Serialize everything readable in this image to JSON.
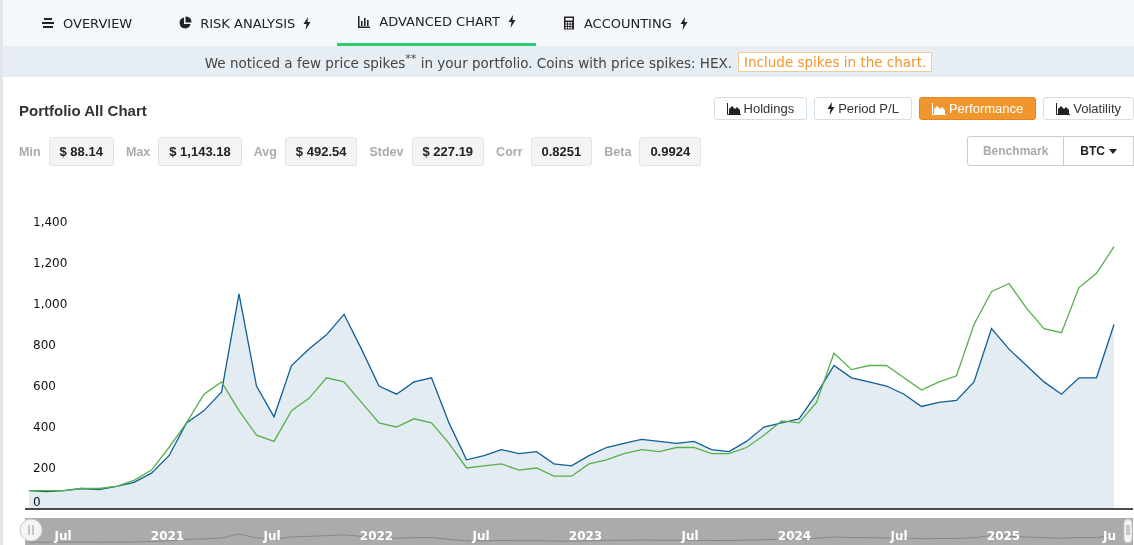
{
  "tabs": [
    {
      "label": "OVERVIEW",
      "kind": "lines",
      "bolt": false,
      "selected": false
    },
    {
      "label": "RISK ANALYSIS",
      "kind": "pie",
      "bolt": true,
      "selected": false
    },
    {
      "label": "ADVANCED CHART",
      "kind": "bars",
      "bolt": true,
      "selected": true
    },
    {
      "label": "ACCOUNTING",
      "kind": "calculator",
      "bolt": true,
      "selected": false
    }
  ],
  "banner": {
    "text": "We noticed a few price spikes$^{**}$ in your portfolio. Coins with price spikes: HEX.",
    "action": "Include spikes in the chart."
  },
  "panel": {
    "title": "Portfolio All Chart",
    "stats": [
      {
        "label": "Min",
        "value": "$ 88.14"
      },
      {
        "label": "Max",
        "value": "$ 1,143.18"
      },
      {
        "label": "Avg",
        "value": "$ 492.54"
      },
      {
        "label": "Stdev",
        "value": "$ 227.19"
      },
      {
        "label": "Corr",
        "value": "0.8251"
      },
      {
        "label": "Beta",
        "value": "0.9924"
      }
    ],
    "modes": [
      {
        "label": "Holdings",
        "kind": "area",
        "selected": false
      },
      {
        "label": "Period P/L",
        "kind": "bolt",
        "selected": false
      },
      {
        "label": "Performance",
        "kind": "area",
        "selected": true
      },
      {
        "label": "Volatility",
        "kind": "area",
        "selected": false
      }
    ],
    "benchmark": {
      "label": "Benchmark",
      "disabled": true,
      "value": "BTC"
    },
    "chart_data": {
      "type": "line",
      "ylim": [
        0,
        1400
      ],
      "yticks": [
        {
          "value": 0,
          "label": "0"
        },
        {
          "value": 200,
          "label": "200"
        },
        {
          "value": 400,
          "label": "400"
        },
        {
          "value": 600,
          "label": "600"
        },
        {
          "value": 800,
          "label": "800"
        },
        {
          "value": 1000,
          "label": "1,000"
        },
        {
          "value": 1200,
          "label": "1,200"
        },
        {
          "value": 1400,
          "label": "1,400"
        }
      ],
      "series": [
        {
          "type": "area",
          "color": "#0f5f96",
          "values": [
            90,
            85,
            90,
            100,
            95,
            110,
            130,
            175,
            260,
            420,
            480,
            570,
            1050,
            600,
            450,
            700,
            780,
            850,
            950,
            780,
            600,
            560,
            620,
            640,
            420,
            240,
            260,
            290,
            270,
            280,
            220,
            210,
            260,
            300,
            320,
            340,
            330,
            320,
            330,
            290,
            280,
            330,
            400,
            420,
            440,
            560,
            700,
            640,
            620,
            600,
            560,
            500,
            520,
            530,
            620,
            880,
            780,
            700,
            620,
            560,
            640,
            640,
            900
          ]
        },
        {
          "type": "line",
          "color": "#55b04a",
          "values": [
            90,
            90,
            90,
            100,
            100,
            110,
            140,
            190,
            300,
            420,
            560,
            620,
            480,
            360,
            330,
            480,
            540,
            640,
            620,
            520,
            420,
            400,
            440,
            420,
            320,
            200,
            210,
            220,
            190,
            200,
            160,
            160,
            220,
            240,
            270,
            290,
            280,
            300,
            300,
            270,
            270,
            300,
            360,
            430,
            420,
            520,
            760,
            680,
            700,
            700,
            640,
            580,
            620,
            650,
            900,
            1060,
            1100,
            980,
            880,
            860,
            1080,
            1150,
            1280
          ]
        }
      ]
    },
    "navigator": {
      "labels": [
        "Jul",
        "2021",
        "Jul",
        "2022",
        "Jul",
        "2023",
        "Jul",
        "2024",
        "Jul",
        "2025",
        "Ju"
      ]
    }
  }
}
